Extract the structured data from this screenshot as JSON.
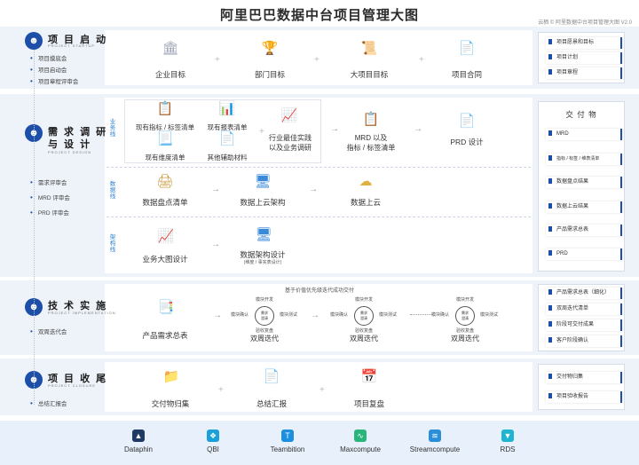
{
  "header": {
    "title": "阿里巴巴数据中台项目管理大图",
    "version": "云栖 © 阿里数据中台项目管理大图 V2.0"
  },
  "phases": {
    "start": {
      "icon": "people-group-icon",
      "title": "项 目 启 动",
      "subtitle": "PROJECT STARTUP",
      "bullets": [
        "项目摸底会",
        "项目启动会",
        "项目章程评审会"
      ],
      "flow": [
        "企业目标",
        "部门目标",
        "大项目目标",
        "项目合同"
      ],
      "outputs": [
        "项目愿景和目标",
        "项目计划",
        "项目章程"
      ]
    },
    "design": {
      "icon": "people-group-icon",
      "title_line1": "需 求 调 研",
      "title_line2": "与 设 计",
      "subtitle": "PROJECT DESIGN",
      "bullets": [
        "需求评审会",
        "MRD 评审会",
        "PRD 评审会"
      ],
      "lanes": {
        "business": {
          "tag": "业务线",
          "items": [
            "现有指标 / 标签清单",
            "现有报表清单",
            "现有维度清单",
            "其他辅助材料"
          ],
          "best": "行业最佳实践\n以及业务调研",
          "mrd": "MRD 以及\n指标 / 标签清单",
          "prd": "PRD 设计"
        },
        "data": {
          "tag": "数据线",
          "flow": [
            "数据盘点清单",
            "数据上云架构",
            "数据上云"
          ]
        },
        "arch": {
          "tag": "架构线",
          "flow": [
            "业务大图设计",
            "数据架构设计"
          ],
          "note": "(维度 / 事实表设计)"
        }
      },
      "outputs_title": "交 付 物",
      "outputs": [
        "MRD",
        "指标 / 标签 / 维表清单",
        "数据盘点结果",
        "数据上云结果",
        "产品需求总表",
        "PRD"
      ]
    },
    "impl": {
      "icon": "people-group-icon",
      "title": "技 术 实 施",
      "subtitle": "PROJECT IMPLEMENTATION",
      "bullets": [
        "双周迭代会"
      ],
      "note": "基于价值优先级迭代成功交付",
      "product_total": "产品需求总表",
      "iteration": "双周迭代",
      "cycle": {
        "top": "模块开发",
        "left": "模块确认",
        "right": "模块测试",
        "bottom": "验收复盘",
        "center": "需求\n澄清"
      },
      "outputs": [
        "产品需求总表（细化）",
        "双周迭代清单",
        "阶段可交付成果",
        "客户阶段确认"
      ]
    },
    "close": {
      "icon": "people-group-icon",
      "title": "项 目 收 尾",
      "subtitle": "PROJECT CLOSURE",
      "bullets": [
        "总结汇报会"
      ],
      "flow": [
        "交付物归集",
        "总结汇报",
        "项目复盘"
      ],
      "outputs": [
        "交付物归集",
        "项目验收报告"
      ]
    }
  },
  "tools": [
    {
      "name": "Dataphin",
      "icon": "dataphin-icon",
      "color": "#1f3a63"
    },
    {
      "name": "QBI",
      "icon": "qbi-icon",
      "color": "#1aa0d8"
    },
    {
      "name": "Teambition",
      "icon": "teambition-icon",
      "color": "#1b8fe0"
    },
    {
      "name": "Maxcompute",
      "icon": "maxcompute-icon",
      "color": "#2ab57d"
    },
    {
      "name": "Streamcompute",
      "icon": "streamcompute-icon",
      "color": "#2a8fd8"
    },
    {
      "name": "RDS",
      "icon": "rds-icon",
      "color": "#1fb5d0"
    }
  ],
  "colors": {
    "accent": "#1e4fa8",
    "band": "#eef3fa",
    "lane_tag": "#2a7fd4"
  }
}
